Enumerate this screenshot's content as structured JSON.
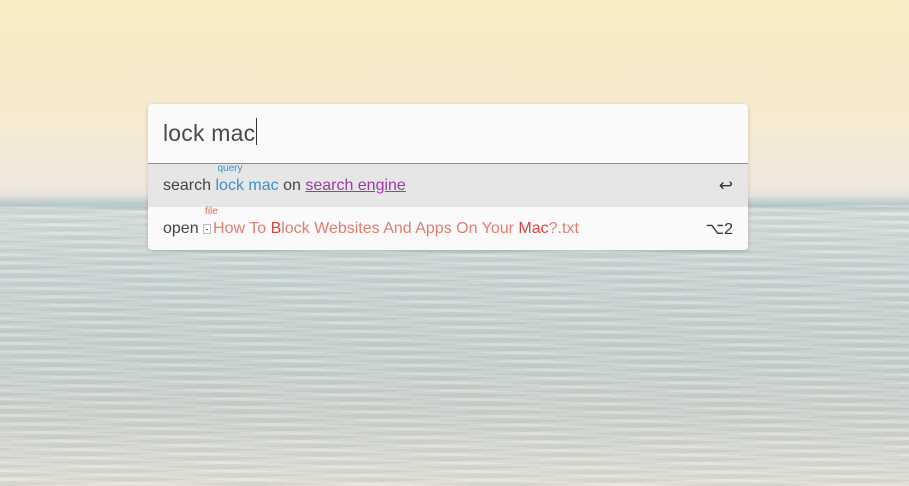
{
  "launcher": {
    "query": "lock mac",
    "results": [
      {
        "action": "search",
        "tag": "query",
        "term": "lock mac",
        "connector": "on",
        "target": "search engine",
        "shortcut": "↩"
      },
      {
        "action": "open",
        "tag": "file",
        "file_parts": [
          "How To ",
          "B",
          "lock",
          " Websites And Apps On Your ",
          "Mac",
          "?.txt"
        ],
        "shortcut": "⌥2"
      }
    ]
  },
  "colors": {
    "query_blue": "#3f8fc7",
    "link_purple": "#9c3aa8",
    "file_red": "#e07d72",
    "selected_row": "#e6e6e6"
  },
  "icons": [
    "file-icon",
    "enter-key-icon"
  ]
}
